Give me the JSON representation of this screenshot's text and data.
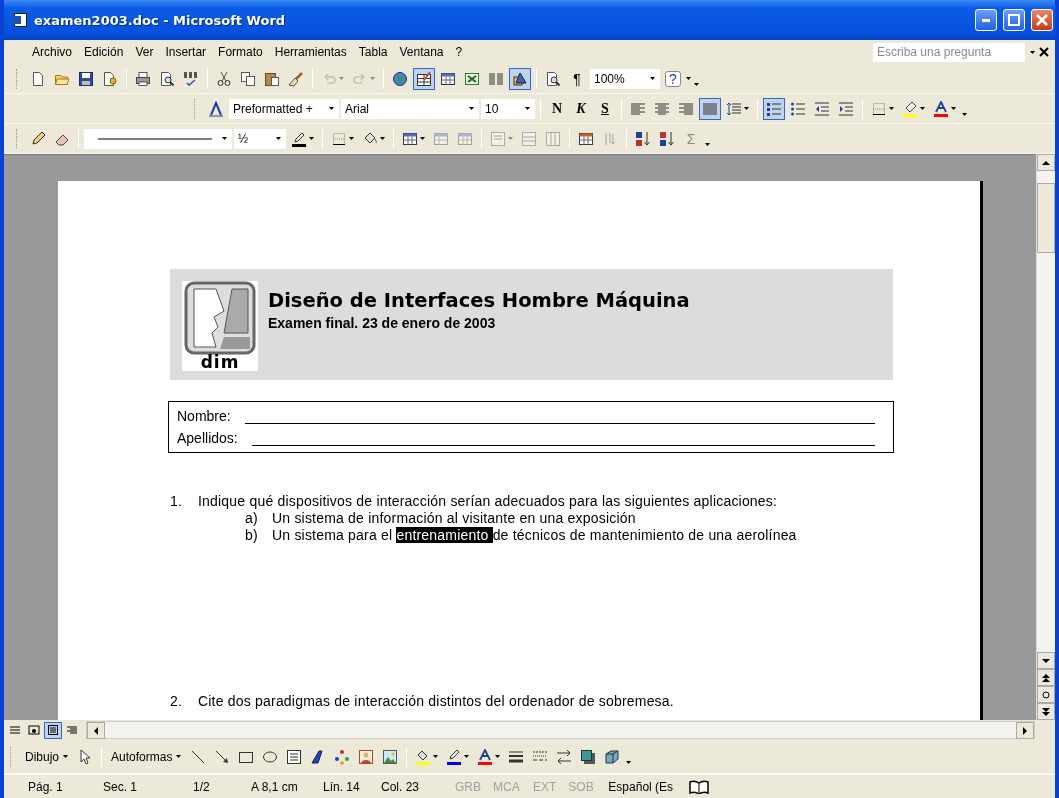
{
  "window": {
    "title": "examen2003.doc - Microsoft Word"
  },
  "menu": [
    "Archivo",
    "Edición",
    "Ver",
    "Insertar",
    "Formato",
    "Herramientas",
    "Tabla",
    "Ventana",
    "?"
  ],
  "ask": {
    "placeholder": "Escriba una pregunta"
  },
  "toolbars": [
    [
      {
        "kind": "icon",
        "pressed": false,
        "disabled": false
      },
      {
        "kind": "icon",
        "pressed": false,
        "disabled": false
      },
      {
        "kind": "icon",
        "pressed": false,
        "disabled": false
      },
      {
        "kind": "icon",
        "pressed": false,
        "disabled": false
      },
      {
        "kind": "sep"
      },
      {
        "kind": "icon",
        "pressed": false,
        "disabled": false
      },
      {
        "kind": "icon",
        "pressed": false,
        "disabled": false
      },
      {
        "kind": "icon",
        "pressed": false,
        "disabled": false
      },
      {
        "kind": "sep"
      },
      {
        "kind": "icon",
        "pressed": false,
        "disabled": false
      },
      {
        "kind": "icon",
        "pressed": false,
        "disabled": false
      },
      {
        "kind": "icon",
        "pressed": false,
        "disabled": false
      },
      {
        "kind": "icon",
        "pressed": false,
        "disabled": false
      },
      {
        "kind": "sep"
      },
      {
        "kind": "split",
        "pressed": false,
        "disabled": true
      },
      {
        "kind": "split",
        "pressed": false,
        "disabled": true
      },
      {
        "kind": "sep"
      },
      {
        "kind": "icon",
        "pressed": false,
        "disabled": false
      },
      {
        "kind": "icon",
        "pressed": true,
        "disabled": false
      },
      {
        "kind": "icon",
        "pressed": false,
        "disabled": false
      },
      {
        "kind": "icon",
        "pressed": false,
        "disabled": false
      },
      {
        "kind": "icon",
        "pressed": false,
        "disabled": false
      },
      {
        "kind": "icon",
        "pressed": true,
        "disabled": false
      },
      {
        "kind": "sep"
      },
      {
        "kind": "icon",
        "pressed": false,
        "disabled": false
      },
      {
        "kind": "glyph",
        "text": "¶",
        "pressed": false,
        "disabled": false
      },
      {
        "kind": "combo",
        "text": "100%"
      },
      {
        "kind": "glyph",
        "text": "?",
        "pressed": false,
        "disabled": false
      },
      {
        "kind": "caret"
      },
      {
        "kind": "chevron"
      }
    ],
    [
      {
        "kind": "icon",
        "pressed": false,
        "disabled": false
      },
      {
        "kind": "combo",
        "text": "Preformatted +"
      },
      {
        "kind": "combo",
        "text": "Arial"
      },
      {
        "kind": "combo",
        "text": "10"
      },
      {
        "kind": "sep"
      },
      {
        "kind": "glyph",
        "text": "N",
        "pressed": false,
        "disabled": false
      },
      {
        "kind": "glyph",
        "text": "K",
        "pressed": false,
        "disabled": false
      },
      {
        "kind": "glyph",
        "text": "S",
        "pressed": false,
        "disabled": false
      },
      {
        "kind": "sep"
      },
      {
        "kind": "icon",
        "pressed": false,
        "disabled": false
      },
      {
        "kind": "icon",
        "pressed": false,
        "disabled": false
      },
      {
        "kind": "icon",
        "pressed": false,
        "disabled": false
      },
      {
        "kind": "icon",
        "pressed": true,
        "disabled": false
      },
      {
        "kind": "split",
        "pressed": false,
        "disabled": false
      },
      {
        "kind": "sep"
      },
      {
        "kind": "icon",
        "pressed": true,
        "disabled": false
      },
      {
        "kind": "icon",
        "pressed": false,
        "disabled": false
      },
      {
        "kind": "icon",
        "pressed": false,
        "disabled": false
      },
      {
        "kind": "icon",
        "pressed": false,
        "disabled": false
      },
      {
        "kind": "sep"
      },
      {
        "kind": "split",
        "pressed": false,
        "disabled": false
      },
      {
        "kind": "split",
        "pressed": false,
        "disabled": false
      },
      {
        "kind": "split",
        "pressed": false,
        "disabled": false
      },
      {
        "kind": "chevron"
      }
    ],
    [
      {
        "kind": "icon",
        "pressed": false,
        "disabled": false
      },
      {
        "kind": "icon",
        "pressed": false,
        "disabled": false
      },
      {
        "kind": "sep"
      },
      {
        "kind": "linecombo"
      },
      {
        "kind": "combo",
        "text": "½"
      },
      {
        "kind": "split",
        "pressed": false,
        "disabled": false
      },
      {
        "kind": "sep"
      },
      {
        "kind": "split",
        "pressed": false,
        "disabled": false
      },
      {
        "kind": "split",
        "pressed": false,
        "disabled": false
      },
      {
        "kind": "sep"
      },
      {
        "kind": "split",
        "pressed": false,
        "disabled": false
      },
      {
        "kind": "icon",
        "pressed": false,
        "disabled": true
      },
      {
        "kind": "icon",
        "pressed": false,
        "disabled": true
      },
      {
        "kind": "sep"
      },
      {
        "kind": "split",
        "pressed": false,
        "disabled": true
      },
      {
        "kind": "icon",
        "pressed": false,
        "disabled": true
      },
      {
        "kind": "icon",
        "pressed": false,
        "disabled": true
      },
      {
        "kind": "sep"
      },
      {
        "kind": "icon",
        "pressed": false,
        "disabled": false
      },
      {
        "kind": "icon",
        "pressed": false,
        "disabled": true
      },
      {
        "kind": "sep"
      },
      {
        "kind": "icon",
        "pressed": false,
        "disabled": false
      },
      {
        "kind": "icon",
        "pressed": false,
        "disabled": false
      },
      {
        "kind": "glyph",
        "text": "Σ",
        "pressed": false,
        "disabled": true
      },
      {
        "kind": "chevron"
      }
    ]
  ],
  "document": {
    "header": {
      "logo_text": "dim",
      "title": "Diseño de Interfaces Hombre Máquina",
      "subtitle": "Examen final. 23 de enero de 2003"
    },
    "fields": [
      {
        "label": "Nombre:"
      },
      {
        "label": "Apellidos:"
      }
    ],
    "questions": [
      {
        "number": "1.",
        "text": "Indique qué dispositivos de interacción serían adecuados para las siguientes aplicaciones:",
        "items": [
          {
            "letter": "a)",
            "before": "Un sistema de información al visitante en una exposición"
          },
          {
            "letter": "b)",
            "before": "Un sistema para el ",
            "selection": "entrenamiento ",
            "after": "de técnicos de mantenimiento de una aerolínea"
          }
        ]
      },
      {
        "number": "2.",
        "text": "Cite dos paradigmas de interacción distintos del ordenador de sobremesa."
      }
    ]
  },
  "views": [
    {
      "selected": false
    },
    {
      "selected": false
    },
    {
      "selected": true
    },
    {
      "selected": false
    }
  ],
  "drawing_toolbar": [
    {
      "kind": "menu",
      "text": "Dibujo"
    },
    {
      "kind": "icon",
      "pressed": false,
      "disabled": false
    },
    {
      "kind": "sep"
    },
    {
      "kind": "menu",
      "text": "Autoformas"
    },
    {
      "kind": "icon",
      "pressed": false,
      "disabled": false
    },
    {
      "kind": "icon",
      "pressed": false,
      "disabled": false
    },
    {
      "kind": "icon",
      "pressed": false,
      "disabled": false
    },
    {
      "kind": "icon",
      "pressed": false,
      "disabled": false
    },
    {
      "kind": "icon",
      "pressed": false,
      "disabled": false
    },
    {
      "kind": "icon",
      "pressed": false,
      "disabled": false
    },
    {
      "kind": "icon",
      "pressed": false,
      "disabled": false
    },
    {
      "kind": "icon",
      "pressed": false,
      "disabled": false
    },
    {
      "kind": "icon",
      "pressed": false,
      "disabled": false
    },
    {
      "kind": "sep"
    },
    {
      "kind": "split",
      "pressed": false,
      "disabled": false
    },
    {
      "kind": "split",
      "pressed": false,
      "disabled": false
    },
    {
      "kind": "split",
      "pressed": false,
      "disabled": false
    },
    {
      "kind": "icon",
      "pressed": false,
      "disabled": false
    },
    {
      "kind": "icon",
      "pressed": false,
      "disabled": false
    },
    {
      "kind": "icon",
      "pressed": false,
      "disabled": false
    },
    {
      "kind": "icon",
      "pressed": false,
      "disabled": false
    },
    {
      "kind": "icon",
      "pressed": false,
      "disabled": false
    },
    {
      "kind": "chevron"
    }
  ],
  "status_bar": [
    {
      "text": "Pág. 1",
      "disabled": false
    },
    {
      "text": "Sec. 1",
      "disabled": false
    },
    {
      "text": "1/2",
      "disabled": false
    },
    {
      "text": "A 8,1 cm",
      "disabled": false
    },
    {
      "text": "Lín. 14",
      "disabled": false
    },
    {
      "text": "Col. 23",
      "disabled": false
    },
    {
      "text": "GRB",
      "disabled": true
    },
    {
      "text": "MCA",
      "disabled": true
    },
    {
      "text": "EXT",
      "disabled": true
    },
    {
      "text": "SOB",
      "disabled": true
    },
    {
      "text": "Español (Es",
      "disabled": false
    }
  ]
}
